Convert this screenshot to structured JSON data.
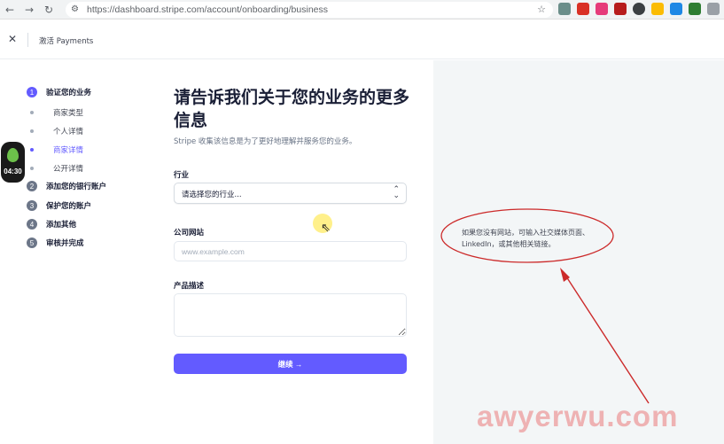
{
  "browser": {
    "url": "https://dashboard.stripe.com/account/onboarding/business",
    "back_icon": "arrow-left-icon",
    "forward_icon": "arrow-right-icon",
    "reload_icon": "reload-icon"
  },
  "header": {
    "title": "激活 Payments",
    "close_icon": "close-icon"
  },
  "stepper": {
    "steps": [
      {
        "num": "1",
        "label": "验证您的业务",
        "active": true
      },
      {
        "num": "2",
        "label": "添加您的银行账户",
        "active": false
      },
      {
        "num": "3",
        "label": "保护您的账户",
        "active": false
      },
      {
        "num": "4",
        "label": "添加其他",
        "active": false
      },
      {
        "num": "5",
        "label": "审核并完成",
        "active": false
      }
    ],
    "substeps": [
      {
        "label": "商家类型",
        "active": false
      },
      {
        "label": "个人详情",
        "active": false
      },
      {
        "label": "商家详情",
        "active": true
      },
      {
        "label": "公开详情",
        "active": false
      }
    ]
  },
  "timer": {
    "time": "04:30"
  },
  "form": {
    "heading": "请告诉我们关于您的业务的更多信息",
    "subtitle": "Stripe 收集该信息是为了更好地理解并服务您的业务。",
    "industry_label": "行业",
    "industry_value": "请选择您的行业...",
    "website_label": "公司网站",
    "website_placeholder": "www.example.com",
    "description_label": "产品描述",
    "continue_label": "继续 →"
  },
  "hint": {
    "text": "如果您没有网站，可输入社交媒体页面、LinkedIn，或其他相关链接。"
  },
  "watermark": "awyerwu.com",
  "colors": {
    "accent": "#635bff",
    "annotation": "#cc2a2a",
    "panel": "#f3f6f7"
  }
}
